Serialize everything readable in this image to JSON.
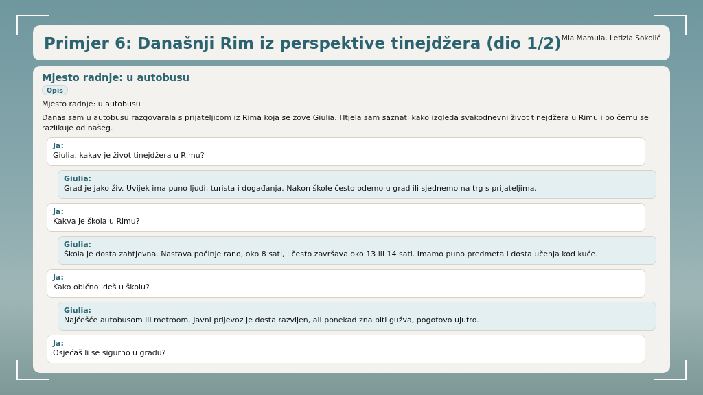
{
  "header": {
    "title": "Primjer 6: Današnji Rim iz perspektive tinejdžera (dio 1/2)",
    "authors": "Mia Mamula, Letizia Sokolić"
  },
  "section": {
    "heading": "Mjesto radnje: u autobusu",
    "tag": "Opis",
    "setting": "Mjesto radnje: u autobusu",
    "intro": "Danas sam u autobusu razgovarala s prijateljicom iz Rima koja se zove Giulia. Htjela sam saznati kako izgleda svakodnevni život tinejdžera u Rimu i po čemu se razlikuje od našeg."
  },
  "messages": [
    {
      "kind": "me",
      "speaker": "Ja:",
      "text": "Giulia, kakav je život tinejdžera u Rimu?"
    },
    {
      "kind": "other",
      "speaker": "Giulia:",
      "text": "Grad je jako živ. Uvijek ima puno ljudi, turista i događanja. Nakon škole često odemo u grad ili sjednemo na trg s prijateljima."
    },
    {
      "kind": "me",
      "speaker": "Ja:",
      "text": "Kakva je škola u Rimu?"
    },
    {
      "kind": "other",
      "speaker": "Giulia:",
      "text": "Škola je dosta zahtjevna. Nastava počinje rano, oko 8 sati, i često završava oko 13 ili 14 sati. Imamo puno predmeta i dosta učenja kod kuće."
    },
    {
      "kind": "me",
      "speaker": "Ja:",
      "text": "Kako obično ideš u školu?"
    },
    {
      "kind": "other",
      "speaker": "Giulia:",
      "text": "Najčešće autobusom ili metroom. Javni prijevoz je dosta razvijen, ali ponekad zna biti gužva, pogotovo ujutro."
    },
    {
      "kind": "me",
      "speaker": "Ja:",
      "text": "Osjećaš li se sigurno u gradu?"
    }
  ]
}
